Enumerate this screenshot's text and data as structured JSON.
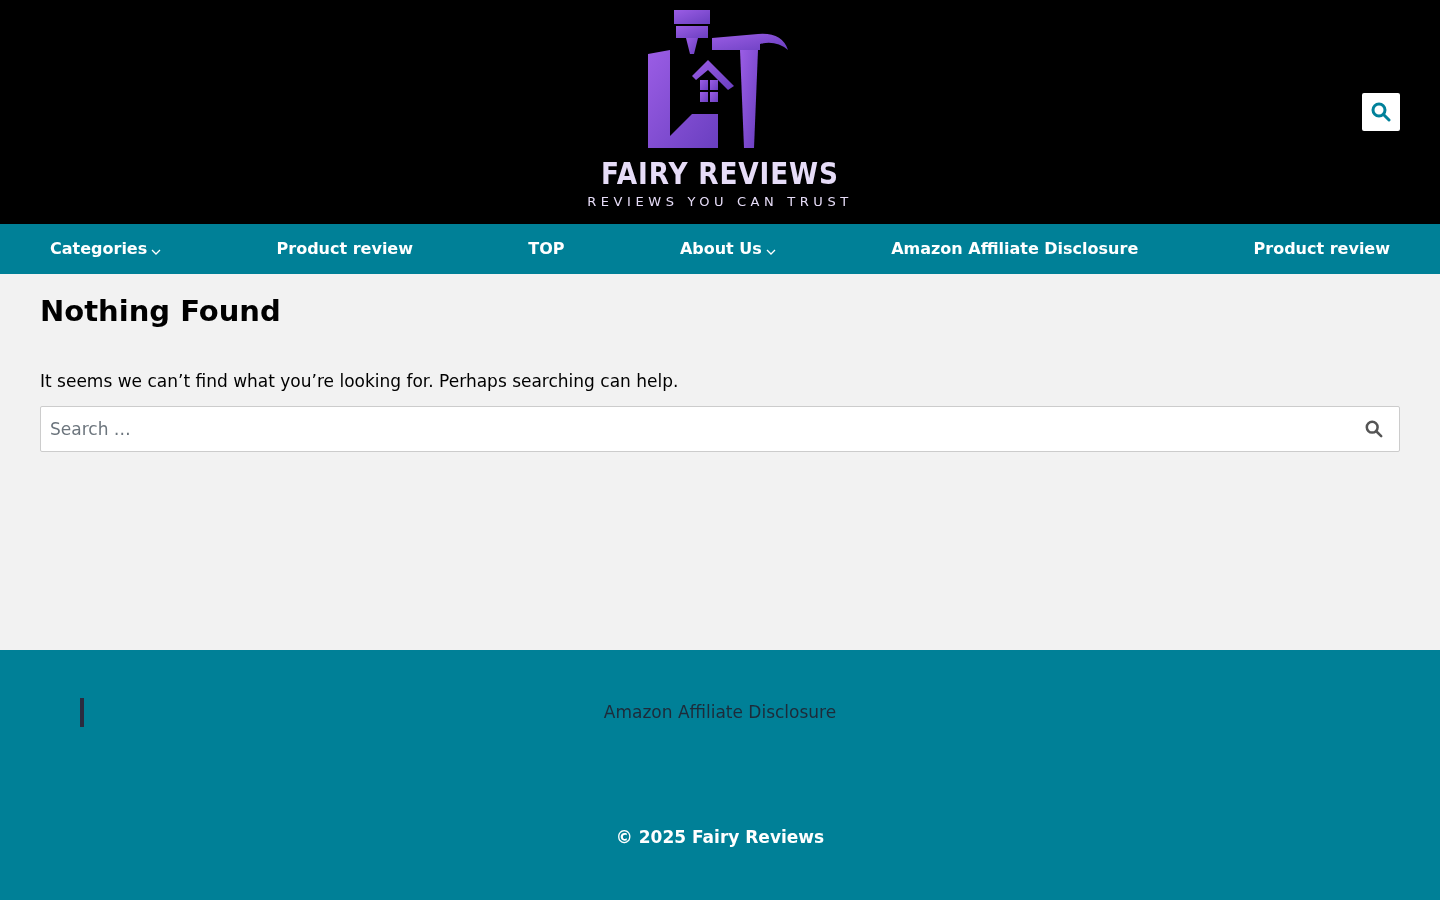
{
  "header": {
    "logo_title": "FAIRY REVIEWS",
    "logo_tagline": "REVIEWS YOU CAN TRUST"
  },
  "nav": [
    {
      "label": "Categories",
      "has_dropdown": true
    },
    {
      "label": "Product review",
      "has_dropdown": false
    },
    {
      "label": "TOP",
      "has_dropdown": false
    },
    {
      "label": "About Us",
      "has_dropdown": true
    },
    {
      "label": "Amazon Affiliate Disclosure",
      "has_dropdown": false
    },
    {
      "label": "Product review",
      "has_dropdown": false
    }
  ],
  "main": {
    "title": "Nothing Found",
    "message": "It seems we can’t find what you’re looking for. Perhaps searching can help.",
    "search": {
      "placeholder": "Search …"
    }
  },
  "footer": {
    "link": "Amazon Affiliate Disclosure",
    "copyright": "© 2025 Fairy Reviews"
  }
}
